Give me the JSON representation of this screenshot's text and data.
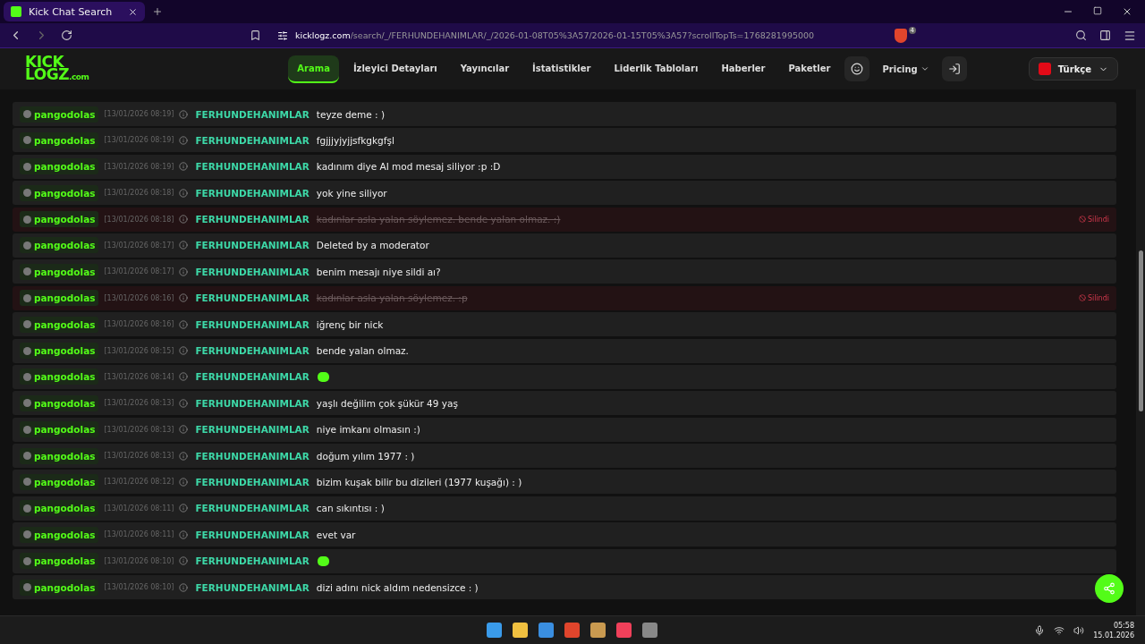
{
  "browser": {
    "tab_title": "Kick Chat Search",
    "url_host": "kicklogz.com",
    "url_path": "/search/_/FERHUNDEHANIMLAR/_/2026-01-08T05%3A57/2026-01-15T05%3A57?scrollTopTs=1768281995000",
    "shield_count": "4"
  },
  "nav": {
    "logo_top": "KICK",
    "logo_bottom": "LOGZ",
    "logo_suffix": ".com",
    "items": [
      {
        "label": "Arama",
        "selected": true
      },
      {
        "label": "İzleyici Detayları",
        "selected": false
      },
      {
        "label": "Yayıncılar",
        "selected": false
      },
      {
        "label": "İstatistikler",
        "selected": false
      },
      {
        "label": "Liderlik Tabloları",
        "selected": false
      },
      {
        "label": "Haberler",
        "selected": false
      },
      {
        "label": "Paketler",
        "selected": false
      }
    ],
    "pricing": "Pricing",
    "language": "Türkçe"
  },
  "messages": [
    {
      "user": "pangodolas",
      "time": "[13/01/2026 08:19]",
      "channel": "FERHUNDEHANIMLAR",
      "kind": "text",
      "text": "teyze deme : )"
    },
    {
      "user": "pangodolas",
      "time": "[13/01/2026 08:19]",
      "channel": "FERHUNDEHANIMLAR",
      "kind": "text",
      "text": "fgjjjyjyjjsfkgkgfşl"
    },
    {
      "user": "pangodolas",
      "time": "[13/01/2026 08:19]",
      "channel": "FERHUNDEHANIMLAR",
      "kind": "text",
      "text": "kadınım diye AI mod mesaj siliyor :p :D"
    },
    {
      "user": "pangodolas",
      "time": "[13/01/2026 08:18]",
      "channel": "FERHUNDEHANIMLAR",
      "kind": "text",
      "text": "yok yine siliyor"
    },
    {
      "user": "pangodolas",
      "time": "[13/01/2026 08:18]",
      "channel": "FERHUNDEHANIMLAR",
      "kind": "deleted",
      "text": "kadınlar asla yalan söylemez. bende yalan olmaz. :)",
      "badge": "Silindi"
    },
    {
      "user": "pangodolas",
      "time": "[13/01/2026 08:17]",
      "channel": "FERHUNDEHANIMLAR",
      "kind": "text",
      "text": "Deleted by a moderator"
    },
    {
      "user": "pangodolas",
      "time": "[13/01/2026 08:17]",
      "channel": "FERHUNDEHANIMLAR",
      "kind": "text",
      "text": "benim mesajı niye sildi aı?"
    },
    {
      "user": "pangodolas",
      "time": "[13/01/2026 08:16]",
      "channel": "FERHUNDEHANIMLAR",
      "kind": "deleted",
      "text": "kadınlar asla yalan söylemez. :p",
      "badge": "Silindi"
    },
    {
      "user": "pangodolas",
      "time": "[13/01/2026 08:16]",
      "channel": "FERHUNDEHANIMLAR",
      "kind": "text",
      "text": "iğrenç bir nick"
    },
    {
      "user": "pangodolas",
      "time": "[13/01/2026 08:15]",
      "channel": "FERHUNDEHANIMLAR",
      "kind": "text",
      "text": "bende yalan olmaz."
    },
    {
      "user": "pangodolas",
      "time": "[13/01/2026 08:14]",
      "channel": "FERHUNDEHANIMLAR",
      "kind": "emote"
    },
    {
      "user": "pangodolas",
      "time": "[13/01/2026 08:13]",
      "channel": "FERHUNDEHANIMLAR",
      "kind": "text",
      "text": "yaşlı değilim çok şükür 49 yaş"
    },
    {
      "user": "pangodolas",
      "time": "[13/01/2026 08:13]",
      "channel": "FERHUNDEHANIMLAR",
      "kind": "text",
      "text": "niye imkanı olmasın :)"
    },
    {
      "user": "pangodolas",
      "time": "[13/01/2026 08:13]",
      "channel": "FERHUNDEHANIMLAR",
      "kind": "text",
      "text": "doğum yılım 1977 : )"
    },
    {
      "user": "pangodolas",
      "time": "[13/01/2026 08:12]",
      "channel": "FERHUNDEHANIMLAR",
      "kind": "text",
      "text": "bizim kuşak bilir bu dizileri (1977 kuşağı) : )"
    },
    {
      "user": "pangodolas",
      "time": "[13/01/2026 08:11]",
      "channel": "FERHUNDEHANIMLAR",
      "kind": "text",
      "text": "can sıkıntısı : )"
    },
    {
      "user": "pangodolas",
      "time": "[13/01/2026 08:11]",
      "channel": "FERHUNDEHANIMLAR",
      "kind": "text",
      "text": "evet var"
    },
    {
      "user": "pangodolas",
      "time": "[13/01/2026 08:10]",
      "channel": "FERHUNDEHANIMLAR",
      "kind": "emote"
    },
    {
      "user": "pangodolas",
      "time": "[13/01/2026 08:10]",
      "channel": "FERHUNDEHANIMLAR",
      "kind": "text",
      "text": "dizi adını nick aldım nedensizce : )"
    }
  ],
  "taskbar": {
    "time": "05:58",
    "date": "15.01.2026"
  }
}
